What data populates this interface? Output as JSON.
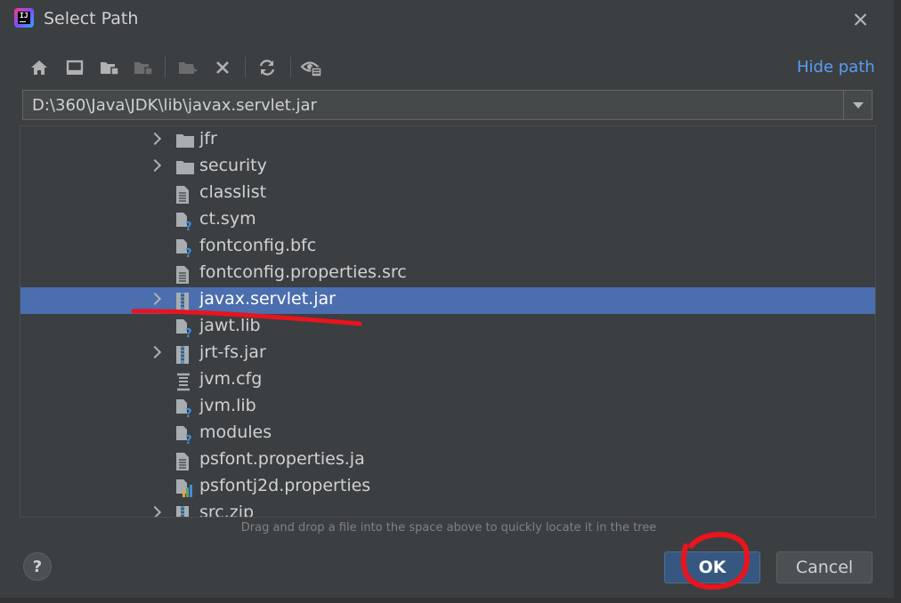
{
  "window": {
    "title": "Select Path",
    "app_icon": "intellij-idea-icon",
    "close_icon": "close-icon"
  },
  "toolbar": {
    "buttons": [
      {
        "name": "home-icon"
      },
      {
        "name": "desktop-icon"
      },
      {
        "name": "project-folder-icon"
      },
      {
        "name": "module-folder-icon"
      },
      {
        "name": "new-folder-icon"
      },
      {
        "name": "delete-icon"
      },
      {
        "name": "refresh-icon"
      },
      {
        "name": "show-hidden-icon"
      }
    ],
    "hide_path_label": "Hide path"
  },
  "path": {
    "value": "D:\\360\\Java\\JDK\\lib\\javax.servlet.jar"
  },
  "tree": {
    "items": [
      {
        "label": "jfr",
        "icon": "folder-icon",
        "expandable": true,
        "selected": false
      },
      {
        "label": "security",
        "icon": "folder-icon",
        "expandable": true,
        "selected": false
      },
      {
        "label": "classlist",
        "icon": "text-file-icon",
        "expandable": false,
        "selected": false
      },
      {
        "label": "ct.sym",
        "icon": "unknown-file-icon",
        "expandable": false,
        "selected": false
      },
      {
        "label": "fontconfig.bfc",
        "icon": "unknown-file-icon",
        "expandable": false,
        "selected": false
      },
      {
        "label": "fontconfig.properties.src",
        "icon": "text-file-icon",
        "expandable": false,
        "selected": false
      },
      {
        "label": "javax.servlet.jar",
        "icon": "jar-archive-icon",
        "expandable": true,
        "selected": true
      },
      {
        "label": "jawt.lib",
        "icon": "unknown-file-icon",
        "expandable": false,
        "selected": false
      },
      {
        "label": "jrt-fs.jar",
        "icon": "jar-archive-icon",
        "expandable": true,
        "selected": false
      },
      {
        "label": "jvm.cfg",
        "icon": "config-file-icon",
        "expandable": false,
        "selected": false
      },
      {
        "label": "jvm.lib",
        "icon": "unknown-file-icon",
        "expandable": false,
        "selected": false
      },
      {
        "label": "modules",
        "icon": "unknown-file-icon",
        "expandable": false,
        "selected": false
      },
      {
        "label": "psfont.properties.ja",
        "icon": "text-file-icon",
        "expandable": false,
        "selected": false
      },
      {
        "label": "psfontj2d.properties",
        "icon": "properties-file-icon",
        "expandable": false,
        "selected": false
      },
      {
        "label": "src.zip",
        "icon": "jar-archive-icon",
        "expandable": true,
        "selected": false
      }
    ]
  },
  "hint": "Drag and drop a file into the space above to quickly locate it in the tree",
  "footer": {
    "help_label": "?",
    "ok_label": "OK",
    "cancel_label": "Cancel"
  },
  "colors": {
    "dialog_bg": "#3c3f41",
    "selection": "#4b6eaf",
    "link": "#589df6",
    "default_button": "#365880",
    "annotation": "#e8141e"
  }
}
